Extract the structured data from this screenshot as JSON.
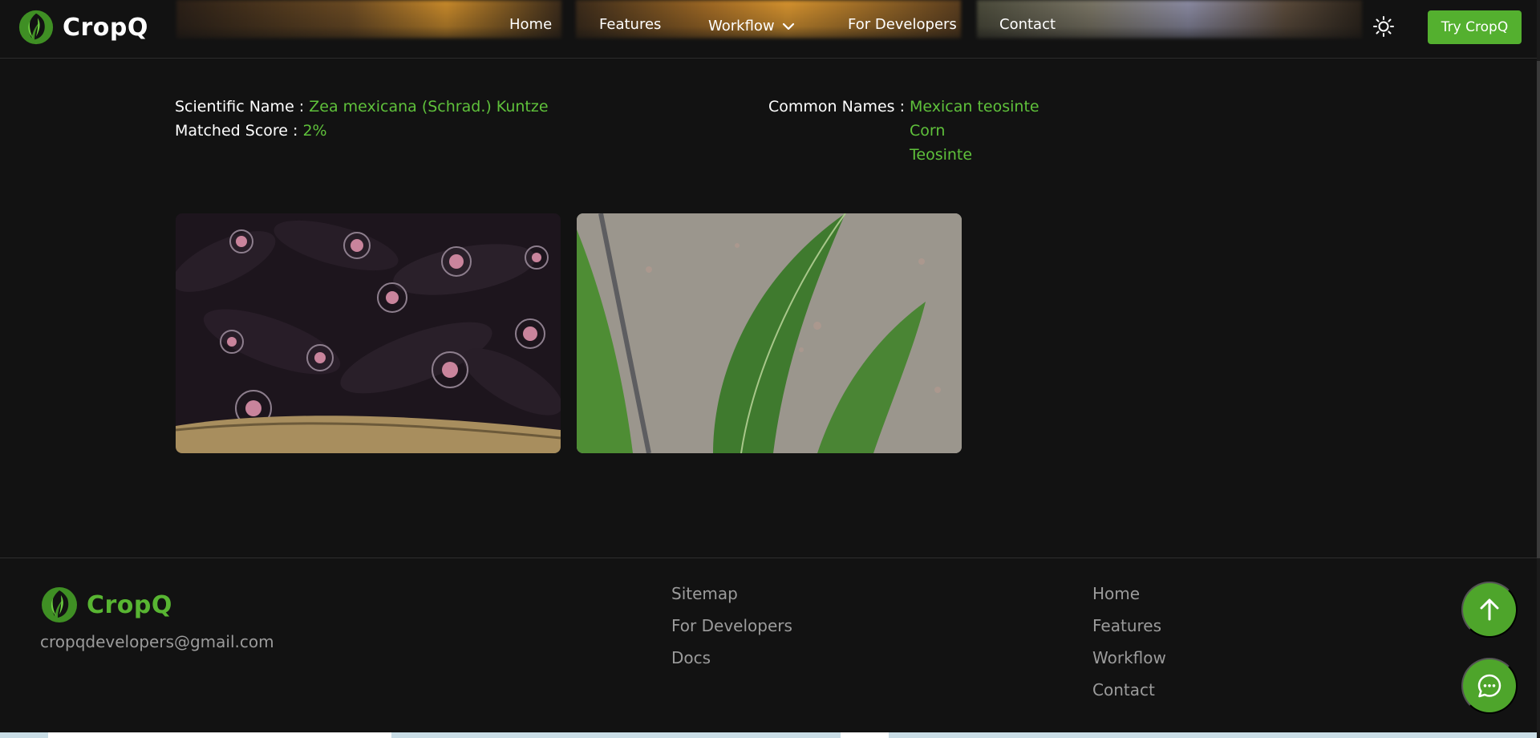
{
  "app": {
    "brand_name": "CropQ",
    "accent_color": "#5fc13b",
    "background_color": "#121212"
  },
  "navbar": {
    "links": [
      {
        "label": "Home"
      },
      {
        "label": "Features"
      },
      {
        "label": "Workflow",
        "icon": "chevron-down-icon"
      },
      {
        "label": "For Developers"
      },
      {
        "label": "Contact"
      }
    ],
    "theme_toggle_icon": "sun-icon",
    "cta_label": "Try CropQ"
  },
  "result": {
    "scientific_name_label": "Scientific Name :",
    "scientific_name": "Zea mexicana (Schrad.) Kuntze",
    "matched_score_label": "Matched Score :",
    "matched_score": "2%",
    "common_names_label": "Common Names :",
    "common_names": [
      "Mexican teosinte",
      "Corn",
      "Teosinte"
    ]
  },
  "gallery": {
    "images": [
      {
        "subject": "dark purple corn cobs in a basket"
      },
      {
        "subject": "green teosinte leaves over gravel"
      }
    ]
  },
  "footer": {
    "brand_name": "CropQ",
    "email": "cropqdevelopers@gmail.com",
    "column1": [
      "Sitemap",
      "For Developers",
      "Docs"
    ],
    "column2": [
      "Home",
      "Features",
      "Workflow",
      "Contact"
    ],
    "scroll_top_icon": "arrow-up-icon",
    "chat_icon": "chat-bubble-icon"
  }
}
